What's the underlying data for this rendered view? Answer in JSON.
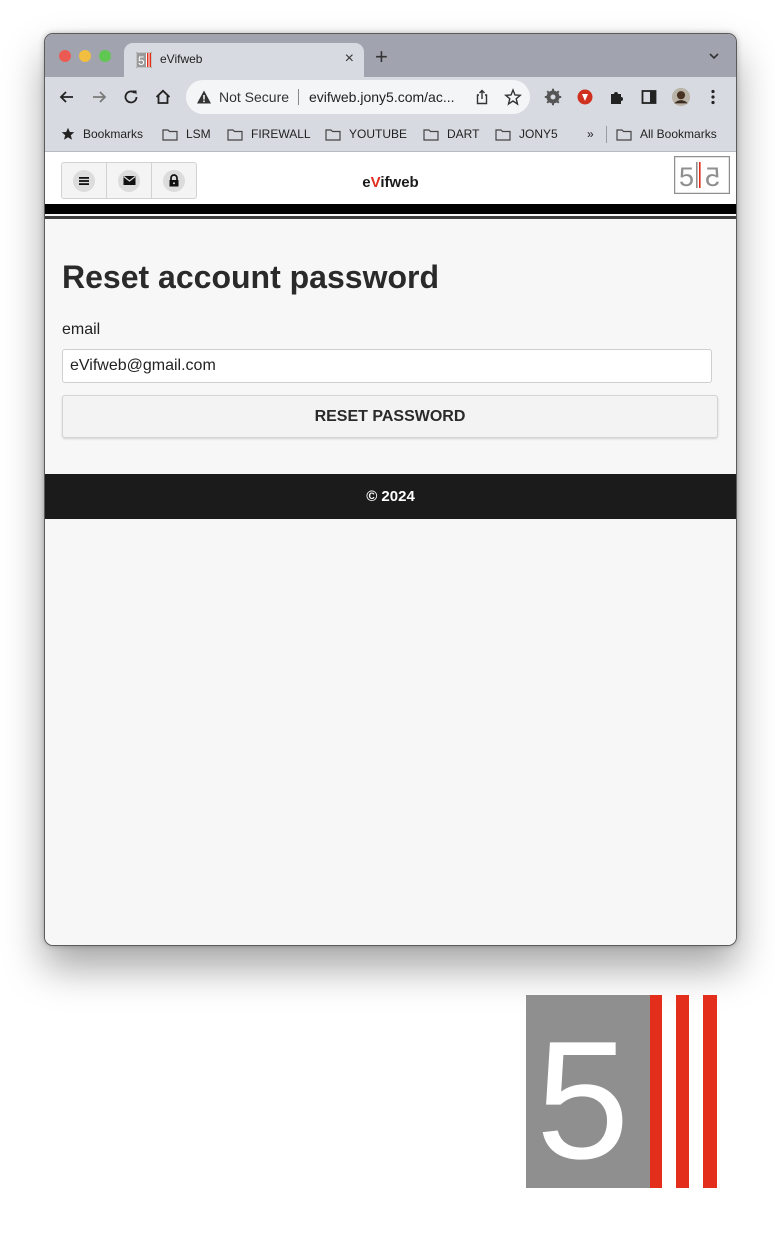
{
  "browser": {
    "tab": {
      "title": "eVifweb",
      "close": "×"
    },
    "new_tab": "+",
    "omnibox": {
      "security_label": "Not Secure",
      "url": "evifweb.jony5.com/ac..."
    },
    "bookmarks": [
      {
        "label": "Bookmarks"
      },
      {
        "label": "LSM"
      },
      {
        "label": "FIREWALL"
      },
      {
        "label": "YOUTUBE"
      },
      {
        "label": "DART"
      },
      {
        "label": "JONY5"
      }
    ],
    "overflow": "»",
    "all_bookmarks": "All Bookmarks"
  },
  "site": {
    "brand_prefix": "e",
    "brand_accent": "V",
    "brand_suffix": "ifweb",
    "brand_accent_color": "#e12c1f",
    "header_icons": [
      "menu-icon",
      "mail-icon",
      "lock-icon"
    ]
  },
  "form": {
    "title": "Reset account password",
    "email_label": "email",
    "email_value": "eVifweb@gmail.com",
    "submit_label": "RESET PASSWORD"
  },
  "footer": {
    "text": "© 2024"
  },
  "colors": {
    "logo_gray": "#8f8f8f",
    "logo_red": "#e42e1c",
    "footer_bg": "#1b1b1b"
  }
}
